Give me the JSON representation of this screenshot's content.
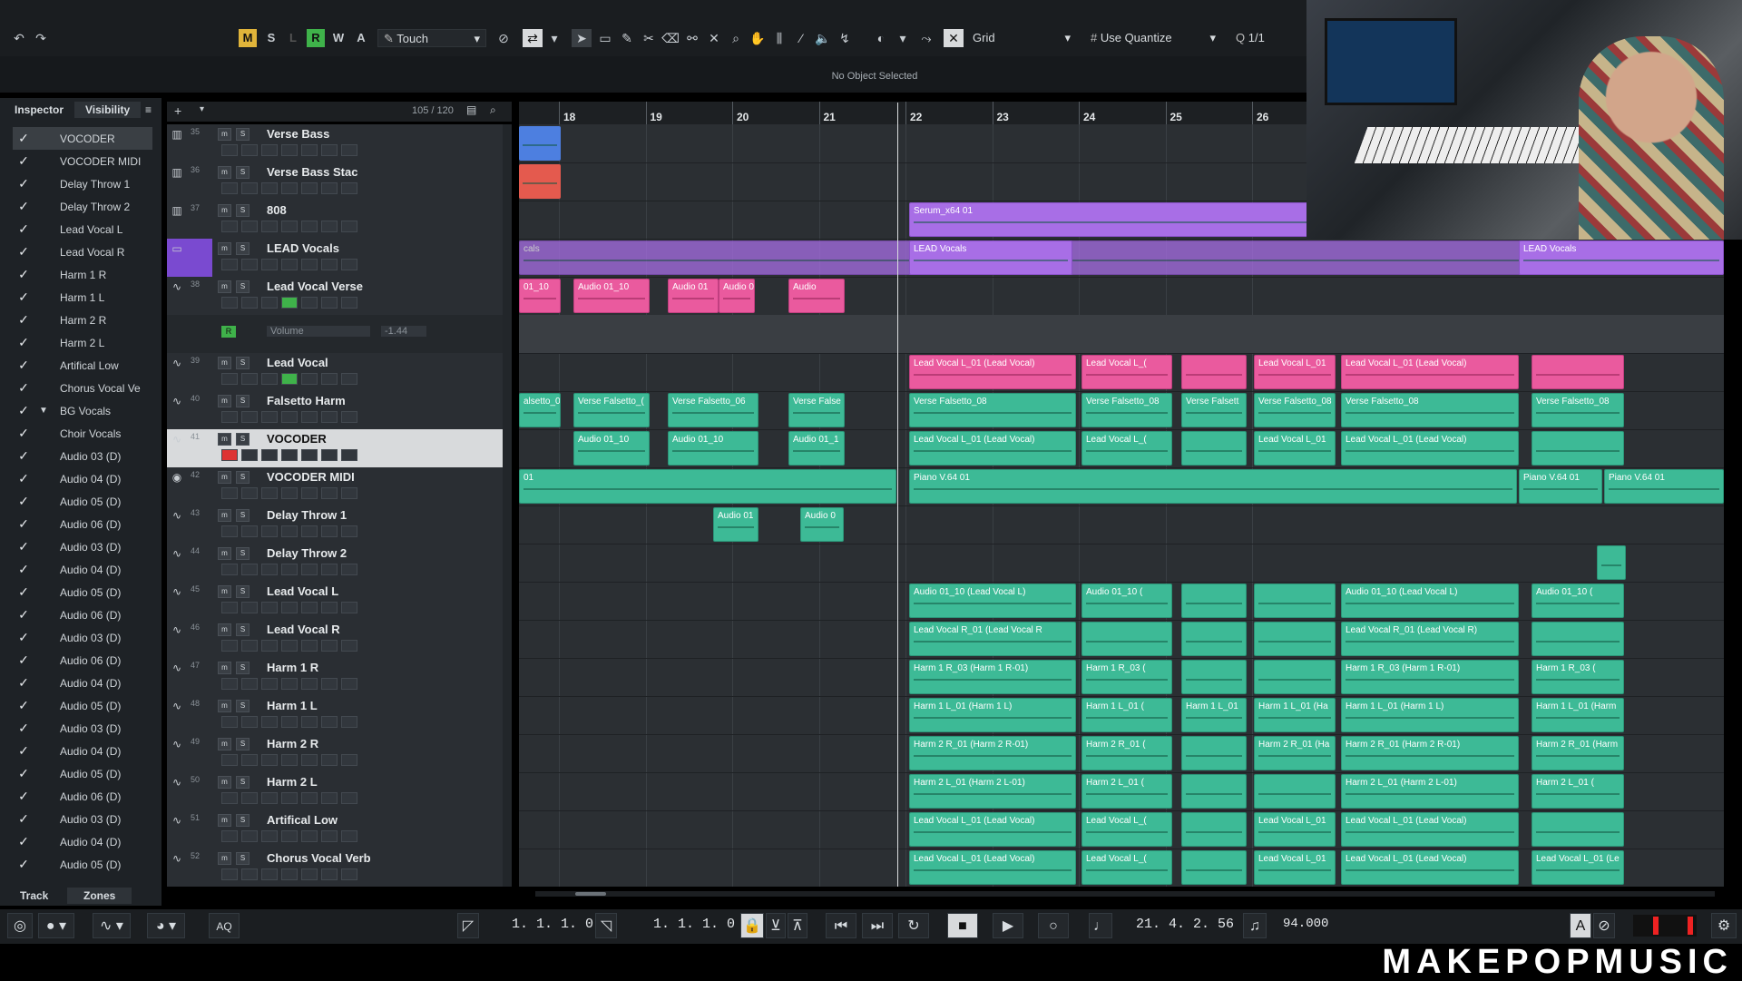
{
  "toolbar": {
    "btn_m": "M",
    "btn_s": "S",
    "btn_l": "L",
    "btn_r": "R",
    "btn_w": "W",
    "btn_a": "A",
    "automation_mode": "Touch",
    "snap_type": "Grid",
    "quantize_label": "Use Quantize",
    "quantize_value": "1/1"
  },
  "info_line": "No Object Selected",
  "inspector": {
    "tab_inspector": "Inspector",
    "tab_visibility": "Visibility",
    "tab_track": "Track",
    "tab_zones": "Zones",
    "visibility_items": [
      {
        "name": "VOCODER"
      },
      {
        "name": "VOCODER MIDI"
      },
      {
        "name": "Delay Throw 1"
      },
      {
        "name": "Delay Throw 2"
      },
      {
        "name": "Lead Vocal L"
      },
      {
        "name": "Lead Vocal R"
      },
      {
        "name": "Harm 1 R"
      },
      {
        "name": "Harm 1 L"
      },
      {
        "name": "Harm 2 R"
      },
      {
        "name": "Harm 2 L"
      },
      {
        "name": "Artifical Low"
      },
      {
        "name": "Chorus Vocal Ve"
      },
      {
        "name": "BG Vocals"
      },
      {
        "name": "Choir Vocals"
      },
      {
        "name": "Audio 03 (D)"
      },
      {
        "name": "Audio 04 (D)"
      },
      {
        "name": "Audio 05 (D)"
      },
      {
        "name": "Audio 06 (D)"
      },
      {
        "name": "Audio 03 (D)"
      },
      {
        "name": "Audio 04 (D)"
      },
      {
        "name": "Audio 05 (D)"
      },
      {
        "name": "Audio 06 (D)"
      },
      {
        "name": "Audio 03 (D)"
      },
      {
        "name": "Audio 06 (D)"
      },
      {
        "name": "Audio 04 (D)"
      },
      {
        "name": "Audio 05 (D)"
      },
      {
        "name": "Audio 03 (D)"
      },
      {
        "name": "Audio 04 (D)"
      },
      {
        "name": "Audio 05 (D)"
      },
      {
        "name": "Audio 06 (D)"
      },
      {
        "name": "Audio 03 (D)"
      },
      {
        "name": "Audio 04 (D)"
      },
      {
        "name": "Audio 05 (D)"
      }
    ]
  },
  "tracklist": {
    "count": "105 / 120",
    "tracks": [
      {
        "num": "35",
        "name": "Verse Bass"
      },
      {
        "num": "36",
        "name": "Verse Bass Stac"
      },
      {
        "num": "37",
        "name": "808"
      },
      {
        "num": "",
        "name": "LEAD Vocals"
      },
      {
        "num": "38",
        "name": "Lead Vocal Verse"
      },
      {
        "num": "",
        "name": ""
      },
      {
        "num": "39",
        "name": "Lead Vocal"
      },
      {
        "num": "40",
        "name": "Falsetto Harm"
      },
      {
        "num": "41",
        "name": "VOCODER"
      },
      {
        "num": "42",
        "name": "VOCODER MIDI"
      },
      {
        "num": "43",
        "name": "Delay Throw 1"
      },
      {
        "num": "44",
        "name": "Delay Throw 2"
      },
      {
        "num": "45",
        "name": "Lead Vocal L"
      },
      {
        "num": "46",
        "name": "Lead Vocal R"
      },
      {
        "num": "47",
        "name": "Harm 1 R"
      },
      {
        "num": "48",
        "name": "Harm 1 L"
      },
      {
        "num": "49",
        "name": "Harm 2 R"
      },
      {
        "num": "50",
        "name": "Harm 2 L"
      },
      {
        "num": "51",
        "name": "Artifical Low"
      },
      {
        "num": "52",
        "name": "Chorus Vocal Verb"
      }
    ],
    "volume_label": "Volume",
    "volume_value": "-1.44"
  },
  "ruler": {
    "bars": [
      "18",
      "19",
      "20",
      "21",
      "22",
      "23",
      "24",
      "25",
      "26"
    ]
  },
  "clips": {
    "serum": "Serum_x64 01",
    "lead_vocals_folder": "LEAD Vocals",
    "lead_vocals_folder_2": "LEAD Vocals",
    "folder_left": "cals",
    "lvv_1": "01_10",
    "lvv_2": "Audio 01_10",
    "lvv_3": "Audio 01",
    "lvv_4": "Audio 0",
    "lvv_5": "Audio",
    "lv_1": "Lead Vocal L_01 (Lead Vocal)",
    "lv_2": "Lead Vocal L_(",
    "lv_3": "Lead Vocal L_01",
    "lv_4": "Lead Vocal L_01 (Lead Vocal)",
    "fh_0": "alsetto_04",
    "fh_1": "Verse Falsetto_(",
    "fh_2": "Verse Falsetto_06",
    "fh_3": "Verse False",
    "fh_4": "Verse Falsetto_08",
    "fh_5": "Verse Falsetto_08",
    "fh_6": "Verse Falsett",
    "fh_7": "Verse Falsetto_08",
    "fh_8": "Verse Falsetto_08",
    "fh_9": "Verse Falsetto_08",
    "voc_1": "Audio 01_10",
    "voc_2": "Audio 01_10",
    "voc_3": "Audio 01_1",
    "voc_4": "Lead Vocal L_01 (Lead Vocal)",
    "voc_5": "Lead Vocal L_(",
    "voc_6": "Lead Vocal L_01",
    "voc_7": "Lead Vocal L_01 (Lead Vocal)",
    "midi_1": "01",
    "midi_2": "Piano V.64 01",
    "midi_3": "Piano V.64 01",
    "midi_4": "Piano V.64 01",
    "dt_1": "Audio 01",
    "dt_2": "Audio 0",
    "lvl_1": "Audio 01_10 (Lead Vocal L)",
    "lvl_2": "Audio 01_10 (",
    "lvl_3": "Audio 01_10 (Lead Vocal L)",
    "lvl_4": "Audio 01_10 (",
    "lvr_1": "Lead Vocal R_01 (Lead Vocal R",
    "lvr_2": "Lead Vocal R_01 (Lead Vocal R)",
    "h1r_1": "Harm 1 R_03 (Harm 1 R-01)",
    "h1r_2": "Harm 1 R_03 (",
    "h1r_3": "Harm 1 R_03 (Harm 1 R-01)",
    "h1r_4": "Harm 1 R_03 (",
    "h1l_1": "Harm 1 L_01 (Harm 1 L)",
    "h1l_2": "Harm 1 L_01 (",
    "h1l_3": "Harm 1 L_01",
    "h1l_4": "Harm 1 L_01 (Ha",
    "h1l_5": "Harm 1 L_01 (Harm 1 L)",
    "h1l_6": "Harm 1 L_01 (Harm",
    "h2r_1": "Harm 2 R_01 (Harm 2 R-01)",
    "h2r_2": "Harm 2 R_01 (",
    "h2r_3": "Harm 2 R_01 (Ha",
    "h2r_4": "Harm 2 R_01 (Harm 2 R-01)",
    "h2r_5": "Harm 2 R_01 (Harm",
    "h2l_1": "Harm 2 L_01 (Harm 2 L-01)",
    "h2l_2": "Harm 2 L_01 (",
    "h2l_3": "Harm 2 L_01 (Harm 2 L-01)",
    "h2l_4": "Harm 2 L_01 (",
    "al_1": "Lead Vocal L_01 (Lead Vocal)",
    "al_2": "Lead Vocal L_(",
    "al_3": "Lead Vocal L_01",
    "al_4": "Lead Vocal L_01 (Lead Vocal)",
    "cv_1": "Lead Vocal L_01 (Lead Vocal)",
    "cv_2": "Lead Vocal L_(",
    "cv_3": "Lead Vocal L_01",
    "cv_4": "Lead Vocal L_01 (Lead Vocal)",
    "cv_5": "Lead Vocal L_01 (Le"
  },
  "transport": {
    "left_locator": "1. 1. 1.   0",
    "right_locator": "1. 1. 1.   0",
    "position": "21. 4. 2. 56",
    "tempo": "94.000",
    "aq_label": "AQ"
  },
  "brand": "MAKEPOPMUSIC",
  "colors": {
    "clip_green": "#3dba96",
    "clip_pink": "#ea5a9e",
    "clip_purple": "#a86ee6",
    "mute_yellow": "#e0b43a",
    "read_green": "#3fb24a"
  }
}
